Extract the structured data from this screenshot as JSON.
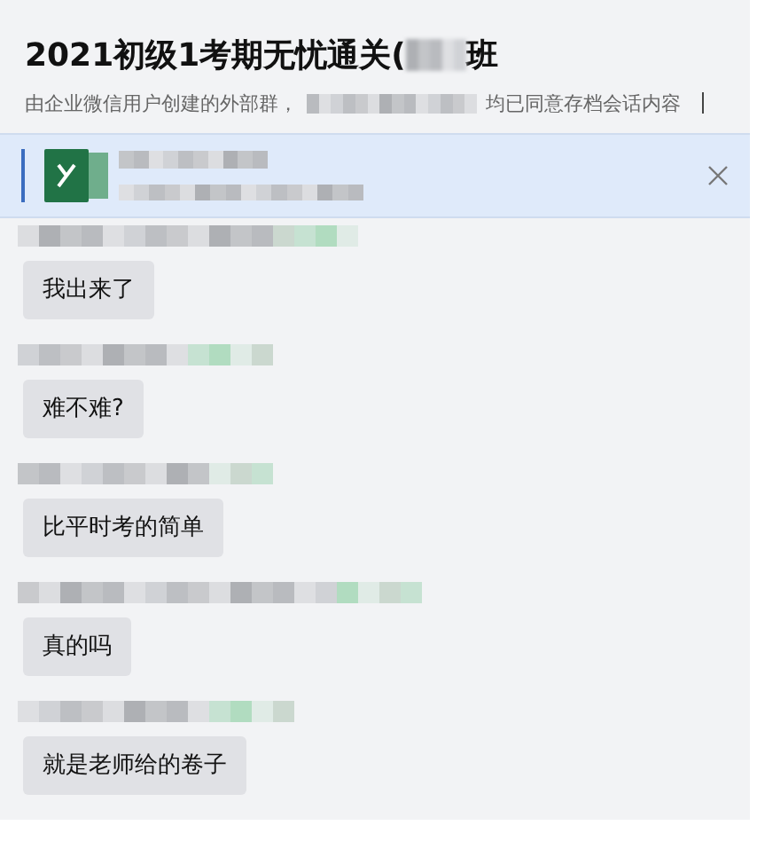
{
  "header": {
    "title_prefix": "2021初级1考期无忧通关(",
    "title_suffix": "班",
    "notice_prefix": "由企业微信用户创建的外部群，",
    "notice_suffix": "均已同意存档会话内容"
  },
  "pinned_file": {
    "kind": "excel"
  },
  "messages": [
    {
      "text": "我出来了"
    },
    {
      "text": "难不难?"
    },
    {
      "text": "比平时考的简单"
    },
    {
      "text": "真的吗"
    },
    {
      "text": "就是老师给的卷子"
    }
  ]
}
